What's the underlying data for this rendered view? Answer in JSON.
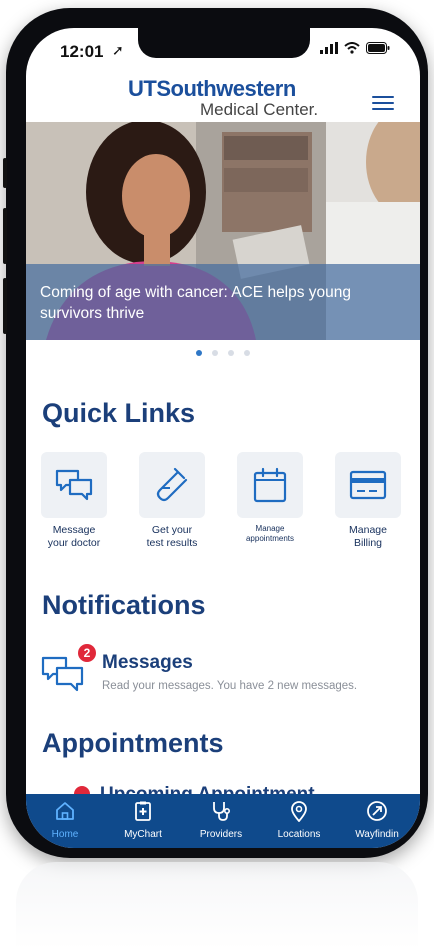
{
  "status_bar": {
    "time": "12:01"
  },
  "header": {
    "logo_line1": "UTSouthwestern",
    "logo_line2": "Medical Center."
  },
  "hero": {
    "caption": "Coming of age with cancer: ACE helps young survivors thrive",
    "slide_count": 4,
    "active_slide": 1
  },
  "quick_links": {
    "title": "Quick Links",
    "items": [
      {
        "icon": "message-icon",
        "label_line1": "Message",
        "label_line2": "your doctor"
      },
      {
        "icon": "test-tube-icon",
        "label_line1": "Get your",
        "label_line2": "test results"
      },
      {
        "icon": "calendar-icon",
        "label_line1": "Manage",
        "label_line2": "appointments"
      },
      {
        "icon": "credit-card-icon",
        "label_line1": "Manage",
        "label_line2": "Billing"
      }
    ]
  },
  "notifications": {
    "title": "Notifications",
    "messages": {
      "title": "Messages",
      "badge": "2",
      "description": "Read your messages. You have 2 new messages."
    }
  },
  "appointments": {
    "title": "Appointments",
    "upcoming_title": "Upcoming Appointment"
  },
  "tabbar": {
    "items": [
      {
        "label": "Home",
        "icon": "home-icon",
        "active": true
      },
      {
        "label": "MyChart",
        "icon": "mychart-icon",
        "active": false
      },
      {
        "label": "Providers",
        "icon": "stethoscope-icon",
        "active": false
      },
      {
        "label": "Locations",
        "icon": "location-pin-icon",
        "active": false
      },
      {
        "label": "Wayfindin",
        "icon": "compass-icon",
        "active": false
      }
    ]
  },
  "colors": {
    "brand_blue": "#1b4f9c",
    "heading_blue": "#1b3f7a",
    "tabbar_bg": "#0f4a8c",
    "badge_red": "#e0283a",
    "active_tab": "#5fb2ff"
  }
}
